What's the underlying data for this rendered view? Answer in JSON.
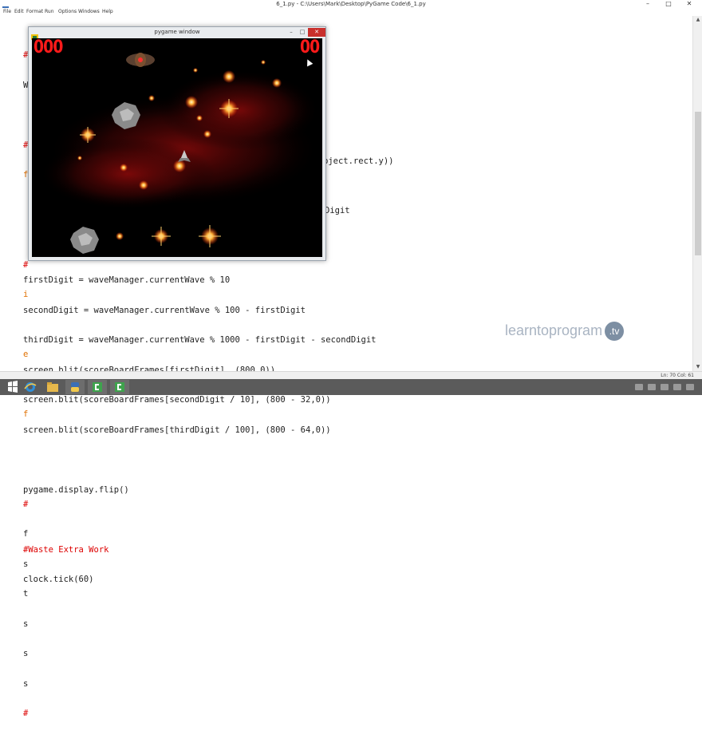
{
  "window": {
    "title": "6_1.py - C:\\Users\\Mark\\Desktop\\PyGame Code\\6_1.py",
    "controls": {
      "minimize": "–",
      "maximize": "□",
      "close": "✕"
    }
  },
  "menu": [
    "File",
    "Edit",
    "Format",
    "Run",
    "Options",
    "Windows",
    "Help"
  ],
  "code_lines": [
    "firstDigit = waveManager.currentWave % 10",
    "secondDigit = waveManager.currentWave % 100 - firstDigit",
    "thirdDigit = waveManager.currentWave % 1000 - firstDigit - secondDigit",
    "screen.blit(scoreBoardFrames[firstDigit], (800,0))",
    "screen.blit(scoreBoardFrames[secondDigit / 10], (800 - 32,0))",
    "screen.blit(scoreBoardFrames[thirdDigit / 100], (800 - 64,0))",
    "",
    "pygame.display.flip()",
    "",
    "#Waste Extra Work",
    "clock.tick(60)"
  ],
  "code_fragments": {
    "object_rect": "bject.rect.y))",
    "digit": "Digit"
  },
  "left_margin_chars": [
    "#",
    "W",
    "#",
    "f",
    "#",
    "i",
    "e",
    "f",
    "#",
    "f",
    "s",
    "t",
    "s",
    "s",
    "s",
    "#"
  ],
  "status": {
    "position": "Ln: 70 Col: 61"
  },
  "pygame_window": {
    "title": "pygame window",
    "score_left": "000",
    "score_right": "00"
  },
  "watermark": {
    "text": "learntoprogram",
    "badge": ".tv"
  },
  "colors": {
    "comment": "#dd0000",
    "code_text": "#222222",
    "score": "#ff1a1a",
    "taskbar": "#5b5b5b"
  },
  "icons": [
    "idle-app-icon",
    "windows-start-icon",
    "ie-icon",
    "file-explorer-icon",
    "python-icon",
    "camtasia-icon",
    "pygame-window-icon"
  ]
}
